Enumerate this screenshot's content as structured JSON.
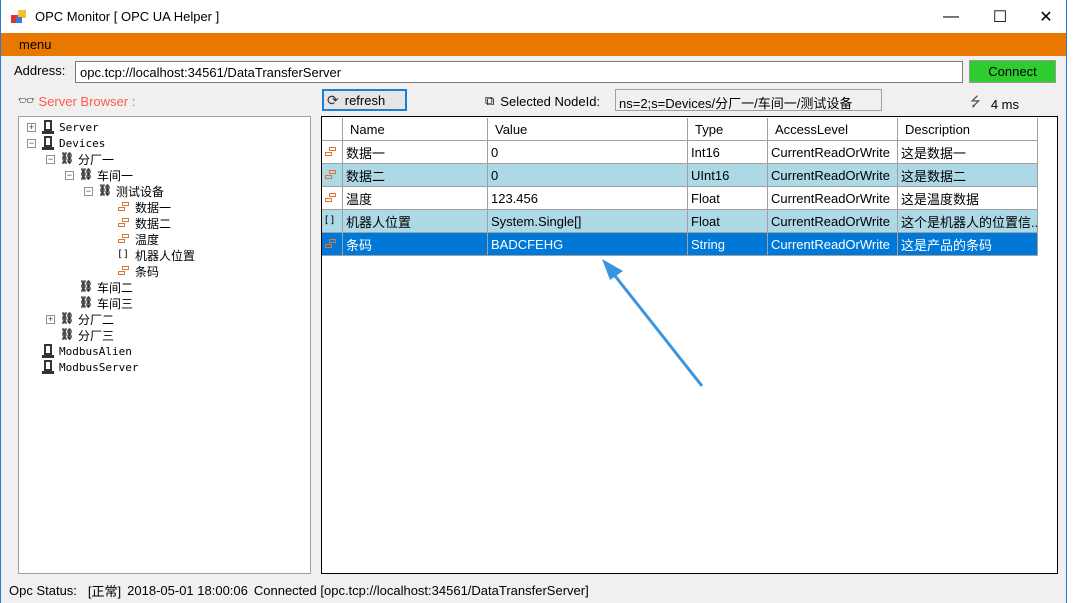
{
  "window": {
    "title": "OPC Monitor [ OPC UA Helper ]",
    "minimize_label": "—",
    "maximize_label": "☐",
    "close_label": "✕"
  },
  "menu": {
    "label": "menu"
  },
  "address": {
    "label": "Address:",
    "value": "opc.tcp://localhost:34561/DataTransferServer",
    "connect_label": "Connect"
  },
  "browser": {
    "label": "Server Browser :"
  },
  "tree": [
    {
      "label": "Server",
      "level": 0,
      "expander": "+",
      "icon": "server-icon"
    },
    {
      "label": "Devices",
      "level": 0,
      "expander": "-",
      "icon": "server-icon"
    },
    {
      "label": "分厂一",
      "level": 1,
      "expander": "-",
      "icon": "object-icon"
    },
    {
      "label": "车间一",
      "level": 2,
      "expander": "-",
      "icon": "object-icon"
    },
    {
      "label": "测试设备",
      "level": 3,
      "expander": "-",
      "icon": "object-icon"
    },
    {
      "label": "数据一",
      "level": 4,
      "expander": "",
      "icon": "variable-icon"
    },
    {
      "label": "数据二",
      "level": 4,
      "expander": "",
      "icon": "variable-icon"
    },
    {
      "label": "温度",
      "level": 4,
      "expander": "",
      "icon": "variable-icon"
    },
    {
      "label": "机器人位置",
      "level": 4,
      "expander": "",
      "icon": "array-icon"
    },
    {
      "label": "条码",
      "level": 4,
      "expander": "",
      "icon": "variable-icon"
    },
    {
      "label": "车间二",
      "level": 2,
      "expander": "",
      "icon": "object-icon"
    },
    {
      "label": "车间三",
      "level": 2,
      "expander": "",
      "icon": "object-icon"
    },
    {
      "label": "分厂二",
      "level": 1,
      "expander": "+",
      "icon": "object-icon"
    },
    {
      "label": "分厂三",
      "level": 1,
      "expander": "",
      "icon": "object-icon"
    },
    {
      "label": "ModbusAlien",
      "level": 0,
      "expander": "",
      "icon": "server-icon"
    },
    {
      "label": "ModbusServer",
      "level": 0,
      "expander": "",
      "icon": "server-icon"
    }
  ],
  "toolbar": {
    "refresh_label": "refresh",
    "selected_label": "Selected NodeId:",
    "selected_value": "ns=2;s=Devices/分厂一/车间一/测试设备",
    "elapsed": "4 ms"
  },
  "grid": {
    "columns": [
      "Name",
      "Value",
      "Type",
      "AccessLevel",
      "Description"
    ],
    "rows": [
      {
        "icon": "variable-icon",
        "cells": [
          "数据一",
          "0",
          "Int16",
          "CurrentReadOrWrite",
          "这是数据一"
        ],
        "style": "white"
      },
      {
        "icon": "variable-icon",
        "cells": [
          "数据二",
          "0",
          "UInt16",
          "CurrentReadOrWrite",
          "这是数据二"
        ],
        "style": "blue"
      },
      {
        "icon": "variable-icon",
        "cells": [
          "温度",
          "123.456",
          "Float",
          "CurrentReadOrWrite",
          "这是温度数据"
        ],
        "style": "white"
      },
      {
        "icon": "array-icon",
        "cells": [
          "机器人位置",
          "System.Single[]",
          "Float",
          "CurrentReadOrWrite",
          "这个是机器人的位置信..."
        ],
        "style": "blue"
      },
      {
        "icon": "variable-icon",
        "cells": [
          "条码",
          "BADCFEHG",
          "String",
          "CurrentReadOrWrite",
          "这是产品的条码"
        ],
        "style": "selected"
      }
    ]
  },
  "status": {
    "label": "Opc Status:",
    "state": "[正常]",
    "time": "2018-05-01 18:00:06",
    "message": "Connected [opc.tcp://localhost:34561/DataTransferServer]"
  },
  "colors": {
    "menu": "#e87800",
    "connect": "#2ecc2e",
    "selected_row": "#0078d7",
    "alt_row": "#add8e6",
    "annotation_arrow": "#3b94e0"
  }
}
